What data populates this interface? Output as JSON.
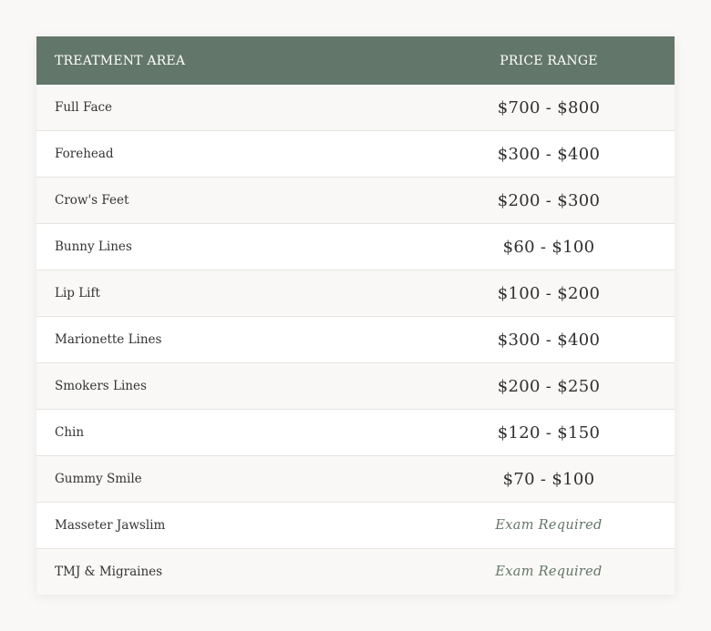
{
  "table": {
    "headers": {
      "area": "TREATMENT AREA",
      "price": "PRICE RANGE"
    },
    "rows": [
      {
        "area": "Full Face",
        "price": "$700 - $800",
        "exam": false
      },
      {
        "area": "Forehead",
        "price": "$300 - $400",
        "exam": false
      },
      {
        "area": "Crow's Feet",
        "price": "$200 - $300",
        "exam": false
      },
      {
        "area": "Bunny Lines",
        "price": "$60 - $100",
        "exam": false
      },
      {
        "area": "Lip Lift",
        "price": "$100 - $200",
        "exam": false
      },
      {
        "area": "Marionette Lines",
        "price": "$300 - $400",
        "exam": false
      },
      {
        "area": "Smokers Lines",
        "price": "$200 - $250",
        "exam": false
      },
      {
        "area": "Chin",
        "price": "$120 - $150",
        "exam": false
      },
      {
        "area": "Gummy Smile",
        "price": "$70 - $100",
        "exam": false
      },
      {
        "area": "Masseter Jawslim",
        "price": "Exam Required",
        "exam": true
      },
      {
        "area": "TMJ & Migraines",
        "price": "Exam Required",
        "exam": true
      }
    ]
  },
  "colors": {
    "header_bg": "#63766a",
    "accent_text": "#63766a",
    "row_alt_bg": "#f9f8f6"
  }
}
